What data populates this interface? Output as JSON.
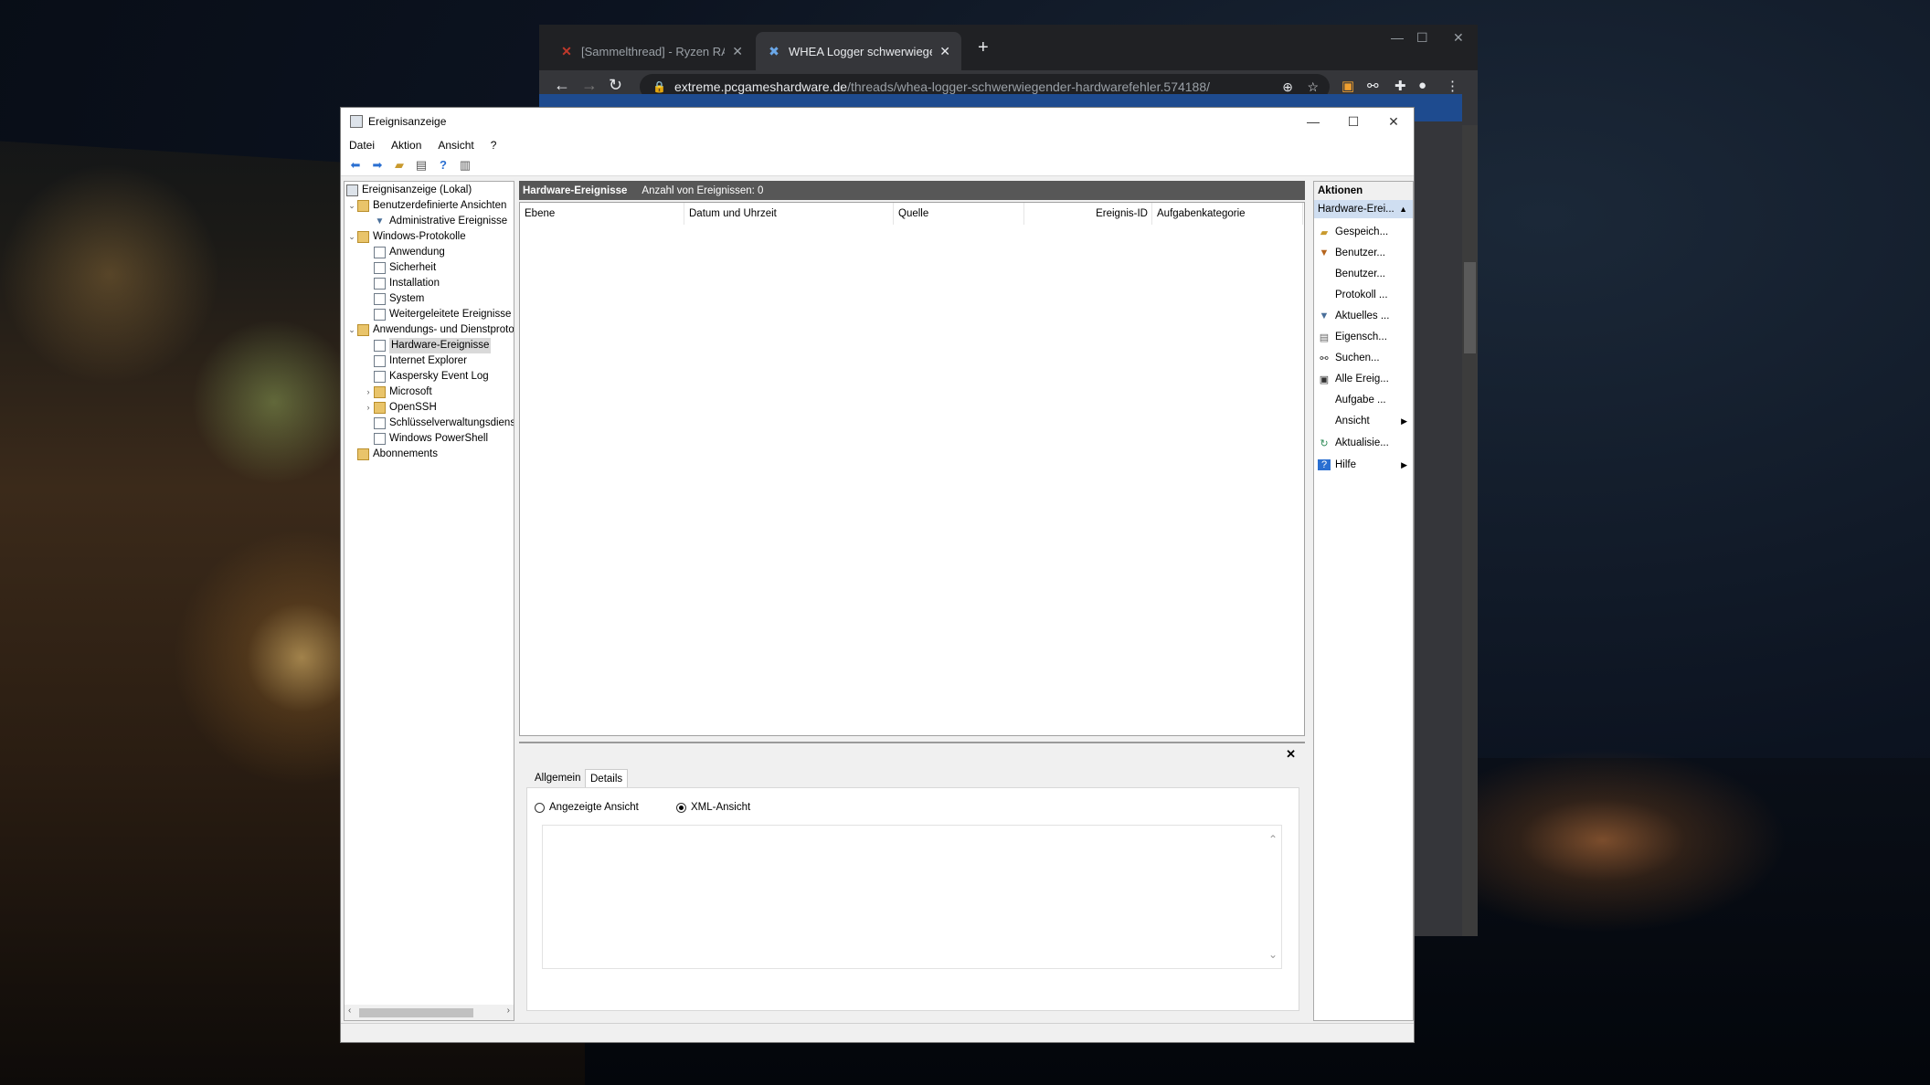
{
  "browser": {
    "tabs": [
      {
        "title": "[Sammelthread] - Ryzen RAM OC",
        "icon": "pcgh-logo-icon"
      },
      {
        "title": "WHEA Logger schwerwiegender",
        "icon": "pcgh-x-icon"
      }
    ],
    "url_host": "extreme.pcgameshardware.de",
    "url_path": "/threads/whea-logger-schwerwiegender-hardwarefehler.574188/"
  },
  "window": {
    "title": "Ereignisanzeige",
    "menu": [
      "Datei",
      "Aktion",
      "Ansicht",
      "?"
    ]
  },
  "tree": {
    "root": "Ereignisanzeige (Lokal)",
    "custom_views": "Benutzerdefinierte Ansichten",
    "admin_events": "Administrative Ereignisse",
    "windows_logs": "Windows-Protokolle",
    "windows_logs_items": [
      "Anwendung",
      "Sicherheit",
      "Installation",
      "System",
      "Weitergeleitete Ereignisse"
    ],
    "app_service_logs": "Anwendungs- und Dienstprotokolle",
    "app_items": [
      "Hardware-Ereignisse",
      "Internet Explorer",
      "Kaspersky Event Log",
      "Microsoft",
      "OpenSSH",
      "Schlüsselverwaltungsdienst",
      "Windows PowerShell"
    ],
    "subscriptions": "Abonnements"
  },
  "center": {
    "log_name": "Hardware-Ereignisse",
    "count_text": "Anzahl von Ereignissen: 0",
    "columns": [
      "Ebene",
      "Datum und Uhrzeit",
      "Quelle",
      "Ereignis-ID",
      "Aufgabenkategorie"
    ]
  },
  "details": {
    "tabs": [
      "Allgemein",
      "Details"
    ],
    "active_tab": "Details",
    "radio_friendly": "Angezeigte Ansicht",
    "radio_xml": "XML-Ansicht",
    "selected_view": "XML-Ansicht"
  },
  "actions": {
    "header": "Aktionen",
    "section": "Hardware-Erei...",
    "items": [
      {
        "label": "Gespeich...",
        "icon": "folder-open-icon"
      },
      {
        "label": "Benutzer...",
        "icon": "filter-icon"
      },
      {
        "label": "Benutzer...",
        "icon": ""
      },
      {
        "label": "Protokoll ...",
        "icon": ""
      },
      {
        "label": "Aktuelles ...",
        "icon": "filter-icon"
      },
      {
        "label": "Eigensch...",
        "icon": "properties-icon"
      },
      {
        "label": "Suchen...",
        "icon": "binoculars-icon"
      },
      {
        "label": "Alle Ereig...",
        "icon": "save-icon"
      },
      {
        "label": "Aufgabe ...",
        "icon": ""
      },
      {
        "label": "Ansicht",
        "icon": "",
        "submenu": true
      },
      {
        "label": "Aktualisie...",
        "icon": "refresh-icon"
      },
      {
        "label": "Hilfe",
        "icon": "help-icon",
        "submenu": true
      }
    ]
  }
}
